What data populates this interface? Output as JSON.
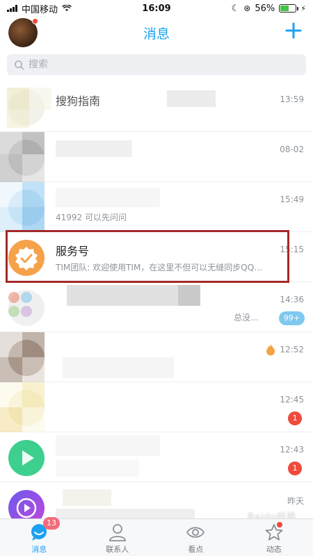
{
  "status_bar": {
    "carrier": "中国移动",
    "time": "16:09",
    "battery_percent": "56%",
    "battery_level": 0.56
  },
  "header": {
    "title": "消息"
  },
  "search": {
    "placeholder": "搜索"
  },
  "conversations": [
    {
      "name": "搜狗指南",
      "preview": "",
      "time": "13:59",
      "badge": ""
    },
    {
      "name": "",
      "preview": "",
      "time": "08-02",
      "badge": ""
    },
    {
      "name": "",
      "preview": "41992 可以先问问",
      "time": "15:49",
      "badge": ""
    },
    {
      "name": "服务号",
      "preview": "TIM团队: 欢迎使用TIM，在这里不但可以无缝同步QQ…",
      "time": "15:15",
      "badge": ""
    },
    {
      "name": "",
      "preview": "总没…",
      "time": "14:36",
      "badge": "99+"
    },
    {
      "name": "",
      "preview": "",
      "time": "12:52",
      "badge": ""
    },
    {
      "name": "",
      "preview": "",
      "time": "12:45",
      "badge": "1"
    },
    {
      "name": "",
      "preview": "",
      "time": "12:43",
      "badge": "1"
    },
    {
      "name": "",
      "preview": "",
      "time": "昨天",
      "badge": ""
    }
  ],
  "tabs": [
    {
      "label": "消息",
      "badge": "13",
      "icon": "message-icon",
      "active": true
    },
    {
      "label": "联系人",
      "badge": "",
      "icon": "contacts-icon",
      "active": false
    },
    {
      "label": "看点",
      "badge": "",
      "icon": "eye-icon",
      "active": false
    },
    {
      "label": "动态",
      "badge": "",
      "icon": "star-icon",
      "active": false
    }
  ],
  "watermark": "Baidu经验",
  "colors": {
    "accent": "#1da1f2",
    "badge_red": "#f04a3c",
    "highlight_border": "#a4282a",
    "service_icon": "#f5a24b"
  }
}
